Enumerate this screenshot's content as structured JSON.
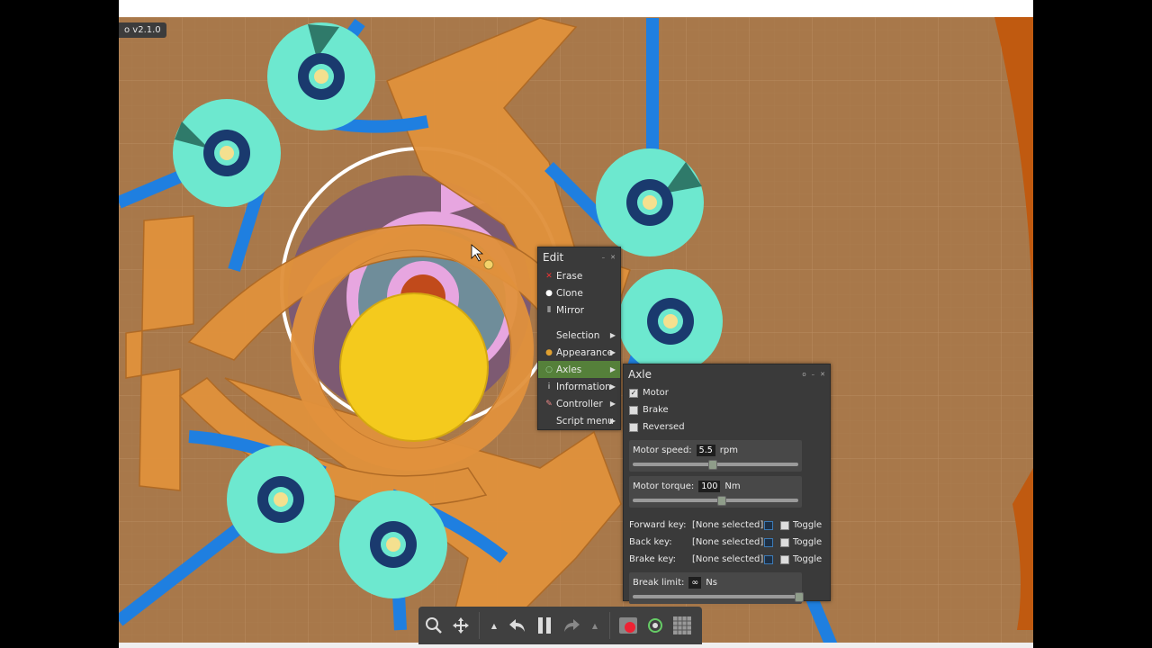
{
  "app": {
    "version": "o v2.1.0"
  },
  "edit_menu": {
    "title": "Edit",
    "items": [
      {
        "label": "Erase",
        "icon": "erase-x-icon"
      },
      {
        "label": "Clone",
        "icon": "clone-icon"
      },
      {
        "label": "Mirror",
        "icon": "mirror-icon"
      }
    ],
    "submenus": [
      {
        "label": "Selection",
        "icon": ""
      },
      {
        "label": "Appearance",
        "icon": "appearance-icon"
      },
      {
        "label": "Axles",
        "icon": "axle-icon",
        "selected": true
      },
      {
        "label": "Information",
        "icon": "info-icon"
      },
      {
        "label": "Controller",
        "icon": "controller-icon"
      },
      {
        "label": "Script menu",
        "icon": ""
      }
    ]
  },
  "axle_panel": {
    "title": "Axle",
    "checkboxes": [
      {
        "label": "Motor",
        "checked": true
      },
      {
        "label": "Brake",
        "checked": false
      },
      {
        "label": "Reversed",
        "checked": false
      }
    ],
    "motor_speed": {
      "label": "Motor speed:",
      "value": "5.5",
      "unit": "rpm",
      "level": 0.48
    },
    "motor_torque": {
      "label": "Motor torque:",
      "value": "100",
      "unit": "Nm",
      "level": 0.53
    },
    "keys": [
      {
        "label": "Forward key:",
        "value": "[None selected]",
        "toggle": "Toggle"
      },
      {
        "label": "Back key:",
        "value": "[None selected]",
        "toggle": "Toggle"
      },
      {
        "label": "Brake key:",
        "value": "[None selected]",
        "toggle": "Toggle"
      }
    ],
    "break_limit": {
      "label": "Break limit:",
      "value": "∞",
      "unit": "Ns",
      "level": 1.0
    }
  },
  "toolbar": {
    "buttons": [
      "zoom-icon",
      "move-icon",
      "undo-icon",
      "pause-icon",
      "redo-icon",
      "record-icon",
      "follow-icon",
      "grid-icon"
    ]
  },
  "colors": {
    "wood": "#a9794a",
    "orange_part": "#e4923a",
    "blue_arm": "#1b7de0",
    "teal_disc": "#6de8cf",
    "yellow_disc": "#f4ca1d",
    "menu_bg": "#3a3a3a",
    "selected": "#55803a"
  }
}
